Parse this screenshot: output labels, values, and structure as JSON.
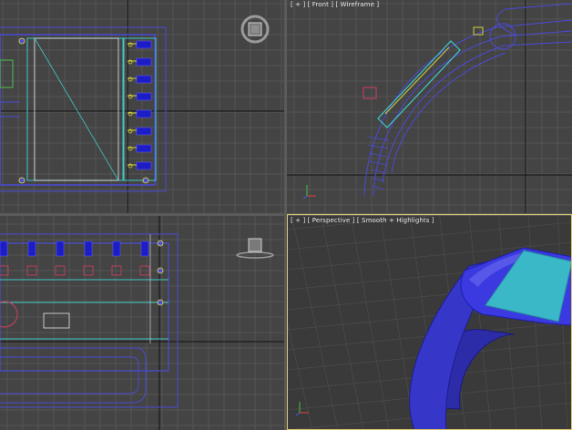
{
  "viewports": {
    "top_left": {
      "label": ""
    },
    "front": {
      "label": "[ + ] [ Front ] [ Wireframe ]"
    },
    "bottom_left": {
      "label": ""
    },
    "perspective": {
      "label": "[ + ] [ Perspective ] [ Smooth + Highlights ]"
    }
  },
  "icons": {
    "view_cube_top": "view-cube-icon",
    "view_cube_left": "view-cube-icon",
    "axis_tripod": "axis-tripod-icon"
  },
  "colors": {
    "viewport_bg": "#444444",
    "grid_line": "#5a5a5a",
    "grid_major": "#1a1a1a",
    "wire_blue": "#4a4ad8",
    "wire_cyan": "#40c8c8",
    "mesh_blue": "#3a3ae0",
    "screen_cyan": "#3ab8c8",
    "active_border": "#d8c46a"
  }
}
